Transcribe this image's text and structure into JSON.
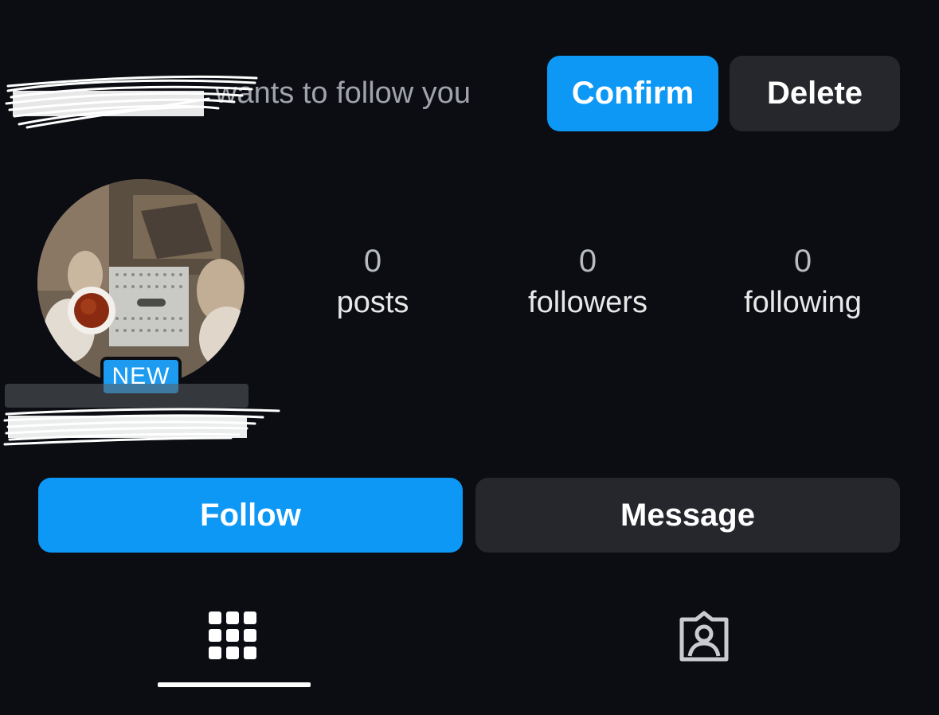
{
  "follow_request": {
    "text": "wants to follow you",
    "confirm_label": "Confirm",
    "delete_label": "Delete"
  },
  "profile": {
    "new_badge": "NEW",
    "stats": {
      "posts": {
        "value": "0",
        "label": "posts"
      },
      "followers": {
        "value": "0",
        "label": "followers"
      },
      "following": {
        "value": "0",
        "label": "following"
      }
    }
  },
  "actions": {
    "follow_label": "Follow",
    "message_label": "Message"
  },
  "tabs": [
    {
      "icon": "grid-icon",
      "active": true
    },
    {
      "icon": "tagged-person-icon",
      "active": false
    }
  ],
  "colors": {
    "background": "#0b0d13",
    "primary_blue": "#0d98f5",
    "secondary_button": "#25272c"
  }
}
